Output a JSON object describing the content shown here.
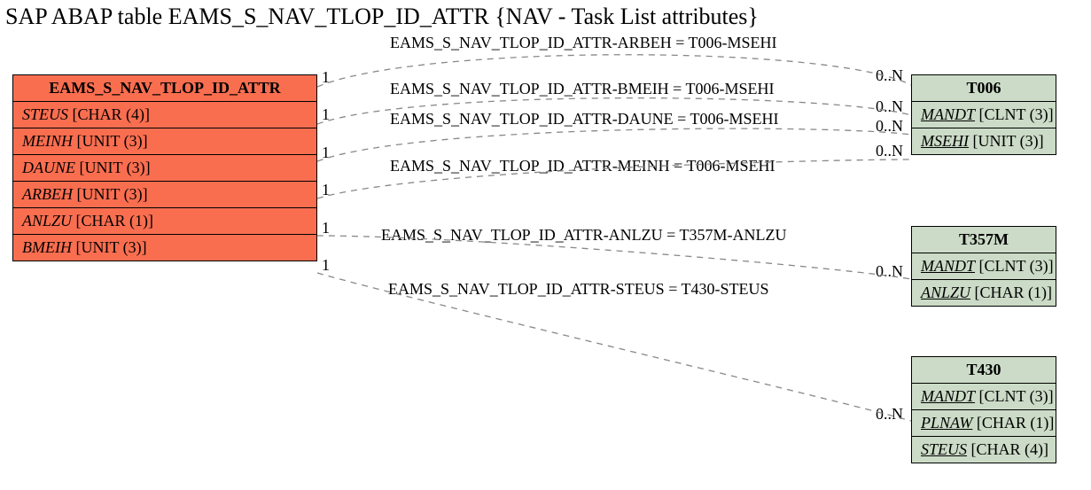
{
  "title": "SAP ABAP table EAMS_S_NAV_TLOP_ID_ATTR {NAV - Task List attributes}",
  "mainEntity": {
    "name": "EAMS_S_NAV_TLOP_ID_ATTR",
    "fields": [
      {
        "name": "STEUS",
        "type": "[CHAR (4)]"
      },
      {
        "name": "MEINH",
        "type": "[UNIT (3)]"
      },
      {
        "name": "DAUNE",
        "type": "[UNIT (3)]"
      },
      {
        "name": "ARBEH",
        "type": "[UNIT (3)]"
      },
      {
        "name": "ANLZU",
        "type": "[CHAR (1)]"
      },
      {
        "name": "BMEIH",
        "type": "[UNIT (3)]"
      }
    ]
  },
  "refEntities": {
    "T006": {
      "name": "T006",
      "fields": [
        {
          "name": "MANDT",
          "type": "[CLNT (3)]",
          "key": true
        },
        {
          "name": "MSEHI",
          "type": "[UNIT (3)]",
          "key": true
        }
      ]
    },
    "T357M": {
      "name": "T357M",
      "fields": [
        {
          "name": "MANDT",
          "type": "[CLNT (3)]",
          "key": true
        },
        {
          "name": "ANLZU",
          "type": "[CHAR (1)]",
          "key": true
        }
      ]
    },
    "T430": {
      "name": "T430",
      "fields": [
        {
          "name": "MANDT",
          "type": "[CLNT (3)]",
          "key": true
        },
        {
          "name": "PLNAW",
          "type": "[CHAR (1)]",
          "key": true
        },
        {
          "name": "STEUS",
          "type": "[CHAR (4)]",
          "key": true
        }
      ]
    }
  },
  "relations": [
    {
      "label": "EAMS_S_NAV_TLOP_ID_ATTR-ARBEH = T006-MSEHI",
      "left": "1",
      "right": "0..N"
    },
    {
      "label": "EAMS_S_NAV_TLOP_ID_ATTR-BMEIH = T006-MSEHI",
      "left": "1",
      "right": "0..N"
    },
    {
      "label": "EAMS_S_NAV_TLOP_ID_ATTR-DAUNE = T006-MSEHI",
      "left": "1",
      "right": "0..N"
    },
    {
      "label": "EAMS_S_NAV_TLOP_ID_ATTR-MEINH = T006-MSEHI",
      "left": "1",
      "right": "0..N"
    },
    {
      "label": "EAMS_S_NAV_TLOP_ID_ATTR-ANLZU = T357M-ANLZU",
      "left": "1",
      "right": "0..N"
    },
    {
      "label": "EAMS_S_NAV_TLOP_ID_ATTR-STEUS = T430-STEUS",
      "left": "1",
      "right": "0..N"
    }
  ]
}
